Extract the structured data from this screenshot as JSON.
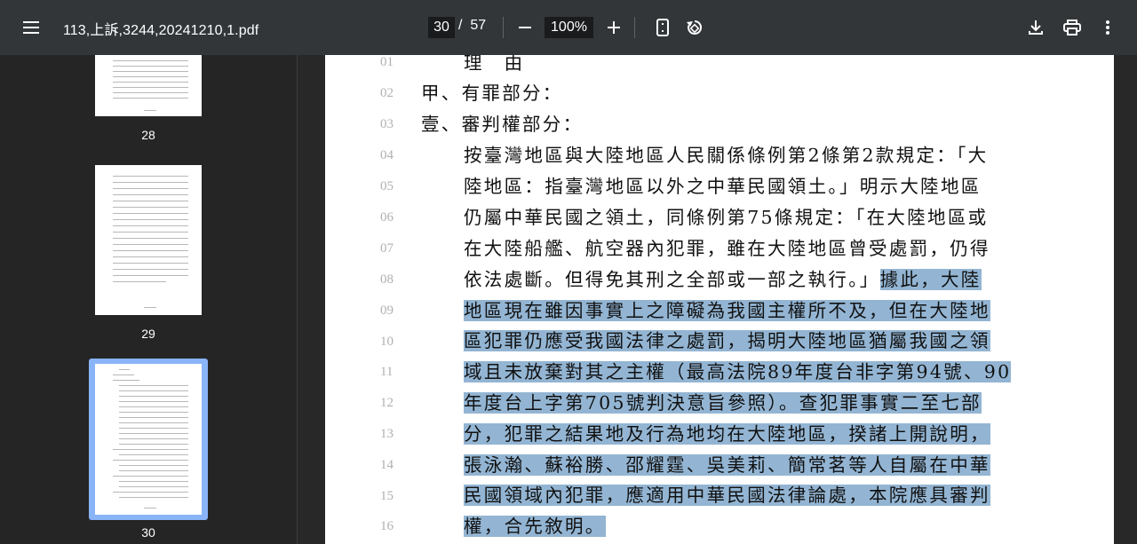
{
  "toolbar": {
    "title": "113,上訴,3244,20241210,1.pdf",
    "current_page": "30",
    "page_sep": "/",
    "total_pages": "57",
    "zoom": "100%"
  },
  "sidebar": {
    "thumbnails": [
      {
        "label": "28"
      },
      {
        "label": "29"
      },
      {
        "label": "30",
        "selected": true
      }
    ]
  },
  "document": {
    "lines": [
      {
        "num": "01",
        "text": "理　由",
        "highlight": ""
      },
      {
        "num": "02",
        "text": "甲、有罪部分：",
        "highlight": ""
      },
      {
        "num": "03",
        "text": "壹、審判權部分：",
        "highlight": ""
      },
      {
        "num": "04",
        "text": "按臺灣地區與大陸地區人民關係條例第2條第2款規定：「大",
        "highlight": ""
      },
      {
        "num": "05",
        "text": "陸地區：指臺灣地區以外之中華民國領土。」明示大陸地區",
        "highlight": ""
      },
      {
        "num": "06",
        "text": "仍屬中華民國之領土，同條例第75條規定：「在大陸地區或",
        "highlight": ""
      },
      {
        "num": "07",
        "text": "在大陸船艦、航空器內犯罪，雖在大陸地區曾受處罰，仍得",
        "highlight": ""
      },
      {
        "num": "08",
        "text": "依法處斷。但得免其刑之全部或一部之執行。」",
        "highlight": "據此，大陸"
      },
      {
        "num": "09",
        "text": "",
        "highlight": "地區現在雖因事實上之障礙為我國主權所不及，但在大陸地"
      },
      {
        "num": "10",
        "text": "",
        "highlight": "區犯罪仍應受我國法律之處罰，揭明大陸地區猶屬我國之領"
      },
      {
        "num": "11",
        "text": "",
        "highlight": "域且未放棄對其之主權（最高法院89年度台非字第94號、90"
      },
      {
        "num": "12",
        "text": "",
        "highlight": "年度台上字第705號判決意旨參照）。查犯罪事實二至七部"
      },
      {
        "num": "13",
        "text": "",
        "highlight": "分，犯罪之結果地及行為地均在大陸地區，揆諸上開說明，"
      },
      {
        "num": "14",
        "text": "",
        "highlight": "張泳瀚、蘇裕勝、邵耀霆、吳美莉、簡常茗等人自屬在中華"
      },
      {
        "num": "15",
        "text": "",
        "highlight": "民國領域內犯罪，應適用中華民國法律論處，本院應具審判"
      },
      {
        "num": "16",
        "text": "",
        "highlight": "權，合先敘明。"
      }
    ]
  }
}
